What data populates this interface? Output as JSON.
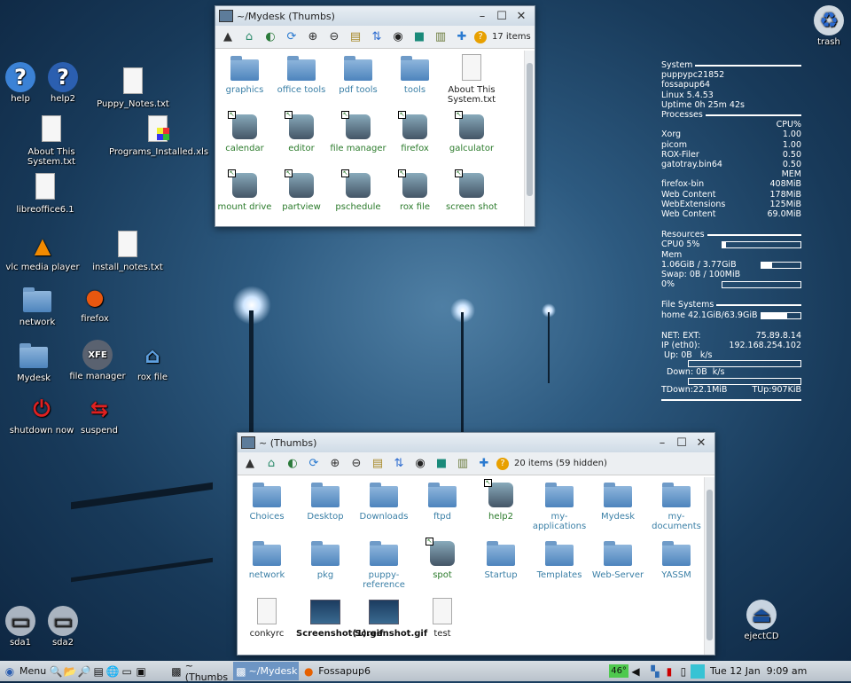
{
  "desktop": {
    "icons": [
      {
        "label": "help",
        "icon": "help-icon"
      },
      {
        "label": "help2",
        "icon": "shield-help-icon"
      },
      {
        "label": "Puppy_Notes.txt",
        "icon": "text-file-icon"
      },
      {
        "label": "About This System.txt",
        "icon": "text-file-icon"
      },
      {
        "label": "Programs_Installed.xls",
        "icon": "spreadsheet-file-icon"
      },
      {
        "label": "libreoffice6.1",
        "icon": "file-icon"
      },
      {
        "label": "vlc media player",
        "icon": "vlc-icon"
      },
      {
        "label": "install_notes.txt",
        "icon": "text-file-icon"
      },
      {
        "label": "network",
        "icon": "folder-icon"
      },
      {
        "label": "firefox",
        "icon": "firefox-icon"
      },
      {
        "label": "Mydesk",
        "icon": "folder-icon"
      },
      {
        "label": "file manager",
        "icon": "file-manager-icon"
      },
      {
        "label": "rox file",
        "icon": "home-icon"
      },
      {
        "label": "shutdown now",
        "icon": "power-icon"
      },
      {
        "label": "suspend",
        "icon": "suspend-icon"
      },
      {
        "label": "sda1",
        "icon": "drive-icon"
      },
      {
        "label": "sda2",
        "icon": "drive-icon"
      },
      {
        "label": "ejectCD",
        "icon": "eject-cd-icon"
      },
      {
        "label": "trash",
        "icon": "trash-icon"
      }
    ]
  },
  "window_mydesk": {
    "title": "~/Mydesk (Thumbs)",
    "count": "17 items",
    "items": [
      {
        "label": "graphics",
        "type": "folder"
      },
      {
        "label": "office tools",
        "type": "folder"
      },
      {
        "label": "pdf tools",
        "type": "folder"
      },
      {
        "label": "tools",
        "type": "folder"
      },
      {
        "label": "About This System.txt",
        "type": "doc"
      },
      {
        "label": "calendar",
        "type": "app"
      },
      {
        "label": "editor",
        "type": "app"
      },
      {
        "label": "file manager",
        "type": "app"
      },
      {
        "label": "firefox",
        "type": "app"
      },
      {
        "label": "galculator",
        "type": "app"
      },
      {
        "label": "mount drive",
        "type": "app"
      },
      {
        "label": "partview",
        "type": "app"
      },
      {
        "label": "pschedule",
        "type": "app"
      },
      {
        "label": "rox file",
        "type": "link"
      },
      {
        "label": "screen shot",
        "type": "app"
      }
    ]
  },
  "window_home": {
    "title": "~ (Thumbs)",
    "count": "20 items (59 hidden)",
    "items": [
      {
        "label": "Choices",
        "type": "folder"
      },
      {
        "label": "Desktop",
        "type": "folder"
      },
      {
        "label": "Downloads",
        "type": "folder"
      },
      {
        "label": "ftpd",
        "type": "folder"
      },
      {
        "label": "help2",
        "type": "link"
      },
      {
        "label": "my-applications",
        "type": "folder"
      },
      {
        "label": "Mydesk",
        "type": "folder"
      },
      {
        "label": "my-documents",
        "type": "folder"
      },
      {
        "label": "network",
        "type": "folder"
      },
      {
        "label": "pkg",
        "type": "folder"
      },
      {
        "label": "puppy-reference",
        "type": "folder"
      },
      {
        "label": "spot",
        "type": "link"
      },
      {
        "label": "Startup",
        "type": "folder"
      },
      {
        "label": "Templates",
        "type": "folder"
      },
      {
        "label": "Web-Server",
        "type": "folder"
      },
      {
        "label": "YASSM",
        "type": "folder"
      },
      {
        "label": "conkyrc",
        "type": "doc"
      },
      {
        "label": "Screenshot(1).gif",
        "type": "image"
      },
      {
        "label": "Screenshot.gif",
        "type": "image"
      },
      {
        "label": "test",
        "type": "doc"
      }
    ]
  },
  "conky": {
    "system_header": "System",
    "hostname": "puppypc21852",
    "distro": "fossapup64",
    "kernel": "Linux 5.4.53",
    "uptime": "Uptime 0h 25m 42s",
    "processes_header": "Processes",
    "cpu_col": "CPU%",
    "cpu_procs": [
      {
        "name": "Xorg",
        "value": "1.00"
      },
      {
        "name": "picom",
        "value": "1.00"
      },
      {
        "name": "ROX-Filer",
        "value": "0.50"
      },
      {
        "name": "gatotray.bin64",
        "value": "0.50"
      }
    ],
    "mem_col": "MEM",
    "mem_procs": [
      {
        "name": "firefox-bin",
        "value": "408MiB"
      },
      {
        "name": "Web Content",
        "value": "178MiB"
      },
      {
        "name": "WebExtensions",
        "value": "125MiB"
      },
      {
        "name": "Web Content",
        "value": "69.0MiB"
      }
    ],
    "resources_header": "Resources",
    "cpu0": "CPU0 5%",
    "cpu0_pct": 5,
    "mem_label": "Mem",
    "mem": "1.06GiB / 3.77GiB",
    "mem_pct": 28,
    "swap": "Swap: 0B   / 100MiB",
    "swap_pct_label": "0%",
    "swap_pct": 0,
    "fs_header": "File Systems",
    "home": "home 42.1GiB/63.9GiB",
    "home_pct": 66,
    "net_ext_label": "NET: EXT:",
    "net_ext": "75.89.8.14",
    "ip_label": "IP (eth0):",
    "ip": "192.168.254.102",
    "up": " Up: 0B   k/s",
    "down": "  Down: 0B  k/s",
    "tdown": "TDown:22.1MiB",
    "tup": "TUp:907KiB"
  },
  "taskbar": {
    "menu": "Menu",
    "tasks": [
      {
        "label": "~ (Thumbs"
      },
      {
        "label": "~/Mydesk"
      },
      {
        "label": "Fossapup6"
      }
    ],
    "temp": "46°",
    "clock": "Tue 12 Jan  9:09 am"
  }
}
